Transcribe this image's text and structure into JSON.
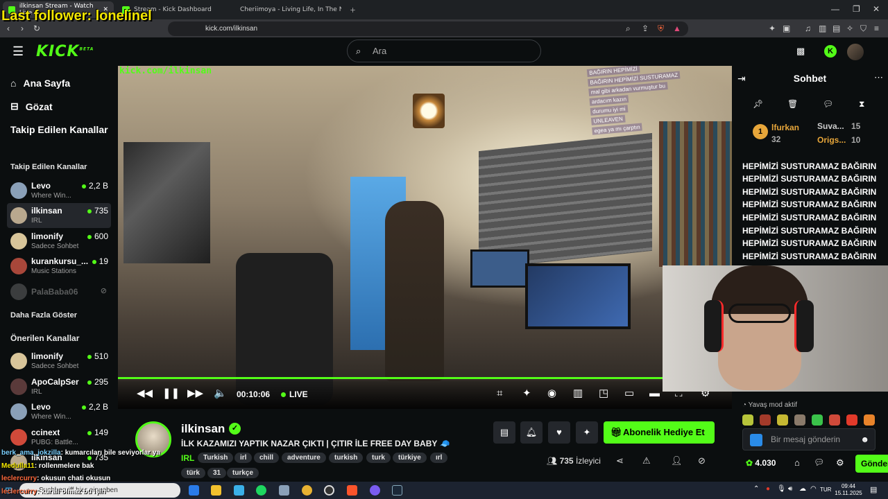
{
  "overlay": {
    "last_follower": "Last follower: lonelinel"
  },
  "browser": {
    "tabs": [
      {
        "label": "ilkinsan Stream - Watch Live"
      },
      {
        "label": "Stream - Kick Dashboard"
      },
      {
        "label": "Cheriimoya - Living Life, In The Night"
      }
    ],
    "url": "kick.com/ilkinsan"
  },
  "header": {
    "logo": "KICK",
    "logo_sup": "BETA",
    "search_placeholder": "Ara"
  },
  "sidebar": {
    "nav": [
      {
        "label": "Ana Sayfa"
      },
      {
        "label": "Gözat"
      },
      {
        "label": "Takip Edilen Kanallar"
      }
    ],
    "following_title": "Takip Edilen Kanallar",
    "following": [
      {
        "name": "Levo",
        "category": "Where Win...",
        "viewers": "2,2 B",
        "color": "#8aa0b8"
      },
      {
        "name": "ilkinsan",
        "category": "IRL",
        "viewers": "735",
        "color": "#b9a88e"
      },
      {
        "name": "limonify",
        "category": "Sadece Sohbet",
        "viewers": "600",
        "color": "#d8c59a"
      },
      {
        "name": "kurankursu_...",
        "category": "Music Stations",
        "viewers": "19",
        "color": "#a8473a"
      },
      {
        "name": "PalaBaba06",
        "category": "",
        "viewers": "",
        "color": "#777777"
      }
    ],
    "show_more": "Daha Fazla Göster",
    "recommended_title": "Önerilen Kanallar",
    "recommended": [
      {
        "name": "limonify",
        "category": "Sadece Sohbet",
        "viewers": "510",
        "color": "#d8c59a"
      },
      {
        "name": "ApoCalpSer",
        "category": "IRL",
        "viewers": "295",
        "color": "#5a3a3a"
      },
      {
        "name": "Levo",
        "category": "Where Win...",
        "viewers": "2,2 B",
        "color": "#8aa0b8"
      },
      {
        "name": "ccinext",
        "category": "PUBG: Battle...",
        "viewers": "149",
        "color": "#d04a3a"
      },
      {
        "name": "ilkinsan",
        "category": "",
        "viewers": "735",
        "color": "#b9a88e"
      }
    ]
  },
  "video": {
    "watermark": "kick.com/ilkinsan",
    "overlay_chat": [
      "BAĞIRIN HEPİMİZİ",
      "BAĞIRIN HEPİMİZİ SUSTURAMAZ",
      "mal gibi arkadan vurmuştur bu",
      "ardacım kazın",
      "durumu iyi mi",
      "UNLEAVEN",
      "egea ya mı çarptın"
    ],
    "time": "00:10:06",
    "live": "LIVE",
    "progress": 1.0
  },
  "stream": {
    "name": "ilkinsan",
    "title": "İLK KAZAMIZI YAPTIK NAZAR ÇIKTI | ÇITIR İLE FREE DAY BABY 🧢",
    "category": "IRL",
    "tags": [
      "Turkish",
      "irl",
      "chill",
      "adventure",
      "turkish",
      "turk",
      "türkiye",
      "ırl",
      "türk",
      "31",
      "turkçe"
    ],
    "gift_label": "Abonelik Hediye Et",
    "viewers": "735",
    "viewers_label": "İzleyici"
  },
  "chat": {
    "title": "Sohbet",
    "leaderboard": [
      {
        "rank": "1",
        "name": "lfurkan",
        "value": "32"
      },
      {
        "name": "Suva...",
        "value": "15"
      },
      {
        "name": "Origs...",
        "value": "10"
      }
    ],
    "messages": [
      "HEPİMİZİ SUSTURAMAZ BAĞIRIN",
      "HEPİMİZİ SUSTURAMAZ BAĞIRIN",
      "HEPİMİZİ SUSTURAMAZ BAĞIRIN",
      "HEPİMİZİ SUSTURAMAZ BAĞIRIN",
      "HEPİMİZİ SUSTURAMAZ BAĞIRIN",
      "HEPİMİZİ SUSTURAMAZ BAĞIRIN",
      "HEPİMİZİ SUSTURAMAZ BAĞIRIN",
      "HEPİMİZİ SUSTURAMAZ BAĞIRIN"
    ],
    "slow_mode": "Yavaş mod aktif",
    "input_placeholder": "Bir mesaj gönderin",
    "points": "4.030",
    "send_label": "Gönder"
  },
  "overlay_chat": [
    {
      "user": "berk_ama_jokzilla",
      "text": ": kumarcıları bile seviyorlar ya"
    },
    {
      "user": "Medulla11",
      "text": ": rollenmelere bak"
    },
    {
      "user": "leclercurry",
      "text": ": okusun chati okusun"
    },
    {
      "user": "leclercurry",
      "text": ": kuralı olmaz bu işin"
    }
  ],
  "taskbar": {
    "search_placeholder": "Suchbegriff hier eingeben",
    "lang": "TUR",
    "time": "09:44",
    "date": "15.11.2025"
  },
  "colors": {
    "accent": "#53fc18",
    "background": "#0b0e0f"
  }
}
